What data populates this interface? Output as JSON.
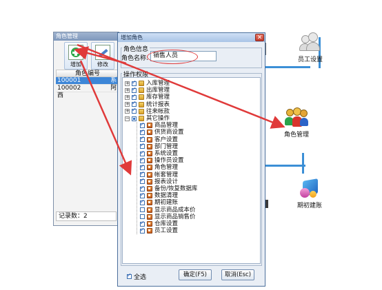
{
  "background": {
    "window_title": "角色管理",
    "toolbar": {
      "add_label": "增加",
      "edit_label": "修改"
    },
    "table": {
      "header": "角色编号",
      "rows": [
        {
          "code": "100001",
          "name": "系统"
        },
        {
          "code": "100002",
          "name": "阿西"
        }
      ]
    },
    "record_count": "记录数：2",
    "desktop_icons": {
      "employee": "员工设置",
      "role": "角色管理",
      "init": "期初建账"
    }
  },
  "dialog": {
    "title": "增加角色",
    "close_glyph": "✕",
    "role_info_title": "角色信息",
    "role_name_label": "角色名称:",
    "role_name_value": "销售人员",
    "permission_title": "操作权限",
    "tree": [
      {
        "label": "入库管理",
        "level": 0,
        "expander": "+",
        "state": "on"
      },
      {
        "label": "出库管理",
        "level": 0,
        "expander": "+",
        "state": "on"
      },
      {
        "label": "库存管理",
        "level": 0,
        "expander": "+",
        "state": "on"
      },
      {
        "label": "统计报表",
        "level": 0,
        "expander": "+",
        "state": "on"
      },
      {
        "label": "往来帐款",
        "level": 0,
        "expander": "+",
        "state": "on"
      },
      {
        "label": "其它操作",
        "level": 0,
        "expander": "−",
        "state": "part"
      },
      {
        "label": "商品管理",
        "level": 1,
        "state": "on"
      },
      {
        "label": "供货商设置",
        "level": 1,
        "state": "on"
      },
      {
        "label": "客户设置",
        "level": 1,
        "state": "on"
      },
      {
        "label": "部门管理",
        "level": 1,
        "state": "on"
      },
      {
        "label": "系统设置",
        "level": 1,
        "state": "on"
      },
      {
        "label": "操作员设置",
        "level": 1,
        "state": "on"
      },
      {
        "label": "角色管理",
        "level": 1,
        "state": "on"
      },
      {
        "label": "帐套管理",
        "level": 1,
        "state": "on"
      },
      {
        "label": "报表设计",
        "level": 1,
        "state": "on"
      },
      {
        "label": "备份/恢复数据库",
        "level": 1,
        "state": "on"
      },
      {
        "label": "数据清理",
        "level": 1,
        "state": "on"
      },
      {
        "label": "期初建账",
        "level": 1,
        "state": "on"
      },
      {
        "label": "显示商品成本价",
        "level": 1,
        "state": "off"
      },
      {
        "label": "显示商品销售价",
        "level": 1,
        "state": "off"
      },
      {
        "label": "仓库设置",
        "level": 1,
        "state": "on"
      },
      {
        "label": "员工设置",
        "level": 1,
        "state": "on"
      }
    ],
    "select_all_label": "全选",
    "ok_label": "确定(F5)",
    "cancel_label": "取消(Esc)"
  },
  "colors": {
    "accent_line": "#3b8fd6",
    "annotation_red": "#e03a3a",
    "selected_row": "#3d86d7"
  }
}
